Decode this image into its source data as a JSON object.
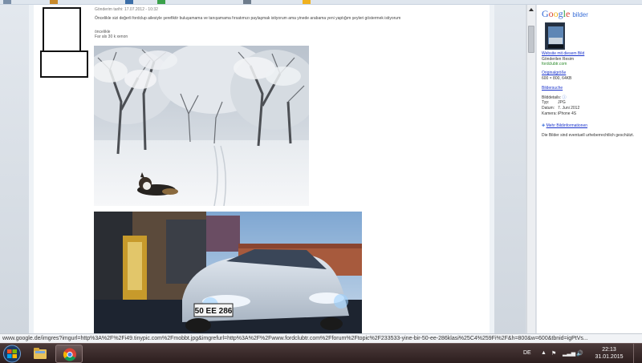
{
  "post": {
    "meta": "Gönderim tarihi: 17.07.2012 - 10:32",
    "text": "Öncelikle sizi değerli fordclup ailesiyle şerefiktir buluşamama ve tanışamama fırsatımızı paylaşmak istiyorum ama yinede arabama yeni yaptığım şeyleri göstermek istiyorum",
    "signature_line1": "öncelikle",
    "signature_line2": "Far als 30 k xenon"
  },
  "sidebar": {
    "logo_google": [
      "G",
      "o",
      "o",
      "g",
      "l",
      "e"
    ],
    "logo_suffix": "bilder",
    "website_link": "Website mit diesem Bild",
    "sent_by": "Gönderilen Resim",
    "domain": "fordclubtr.com",
    "original_link": "Originalgröße",
    "size": "600 × 800, 64KB",
    "search_link": "Bildersuche",
    "details_label": "Bilddetails:",
    "details": [
      {
        "key": "Typ:",
        "value": "JPG"
      },
      {
        "key": "Datum:",
        "value": "7. Juni 2012"
      },
      {
        "key": "Kamera:",
        "value": "iPhone 4S"
      }
    ],
    "more_info": "Mehr Bildinformationen",
    "copyright": "Die Bilder sind eventuell urheberrechtlich geschützt."
  },
  "status_url": "www.google.de/imgres?imgurl=http%3A%2F%2Fi49.tinypic.com%2Fmobbt.jpg&imgrefurl=http%3A%2F%2Fwww.fordclubtr.com%2Fforum%2Ftopic%2F233533-yine-bir-50-ee-286klasi%25C4%259Fi%2F&h=800&w=600&tbnid=igPtVs...",
  "car_plate": "50 EE 286",
  "taskbar": {
    "lang": "DE",
    "time": "22:13",
    "date": "31.01.2015"
  }
}
